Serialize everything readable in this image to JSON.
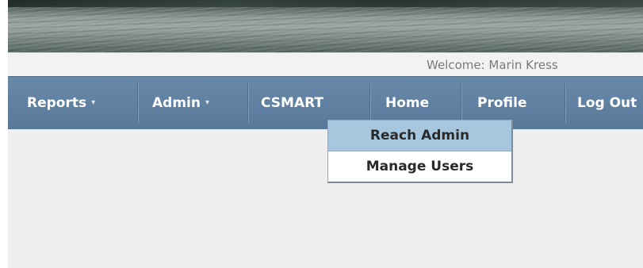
{
  "header": {
    "welcome": "Welcome: Marin Kress"
  },
  "nav": {
    "items": [
      {
        "label": "Reports",
        "has_caret": true
      },
      {
        "label": "Admin",
        "has_caret": true
      },
      {
        "label": "CSMART",
        "has_caret": false
      },
      {
        "label": "Home",
        "has_caret": false
      },
      {
        "label": "Profile",
        "has_caret": false
      },
      {
        "label": "Log Out",
        "has_caret": false
      }
    ],
    "caret_glyph": "▾"
  },
  "admin_menu": {
    "items": [
      {
        "label": "Reach Admin",
        "highlighted": true
      },
      {
        "label": "Manage Users",
        "highlighted": false
      }
    ]
  },
  "colors": {
    "navbar": "#6283a3",
    "highlight": "#a6c7de",
    "background": "#efefef"
  }
}
